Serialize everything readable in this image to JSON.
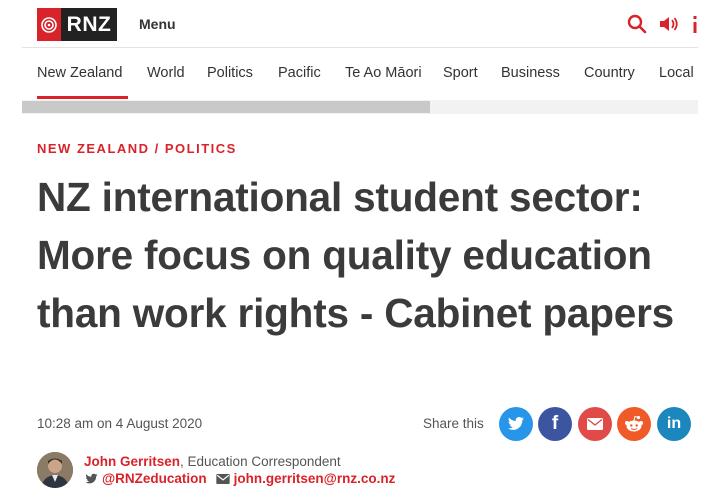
{
  "header": {
    "logo_text": "RNZ",
    "menu_label": "Menu",
    "icons": [
      "search-icon",
      "audio-icon",
      "more-icon"
    ]
  },
  "nav": {
    "items": [
      {
        "label": "New Zealand",
        "active": true
      },
      {
        "label": "World"
      },
      {
        "label": "Politics"
      },
      {
        "label": "Pacific"
      },
      {
        "label": "Te Ao Māori"
      },
      {
        "label": "Sport"
      },
      {
        "label": "Business"
      },
      {
        "label": "Country"
      },
      {
        "label": "Local"
      }
    ]
  },
  "article": {
    "breadcrumb": "NEW ZEALAND / POLITICS",
    "headline": "NZ international student sector: More focus on quality education than work rights - Cabinet papers",
    "dateline": "10:28 am on 4 August 2020",
    "share_label": "Share this",
    "share_buttons": [
      {
        "name": "twitter",
        "glyph": "🐦",
        "color": "#2795e9"
      },
      {
        "name": "facebook",
        "glyph": "f",
        "color": "#3b55a0"
      },
      {
        "name": "email",
        "glyph": "✉",
        "color": "#e04b47"
      },
      {
        "name": "reddit",
        "glyph": "👽",
        "color": "#f05a28"
      },
      {
        "name": "linkedin",
        "glyph": "in",
        "color": "#1c87bd"
      }
    ]
  },
  "author": {
    "name": "John Gerritsen",
    "role": ", Education Correspondent",
    "twitter_handle": "@RNZeducation",
    "email": "john.gerritsen@rnz.co.nz"
  },
  "colors": {
    "brand_red": "#d8232a",
    "headline": "#3b3b3b"
  }
}
